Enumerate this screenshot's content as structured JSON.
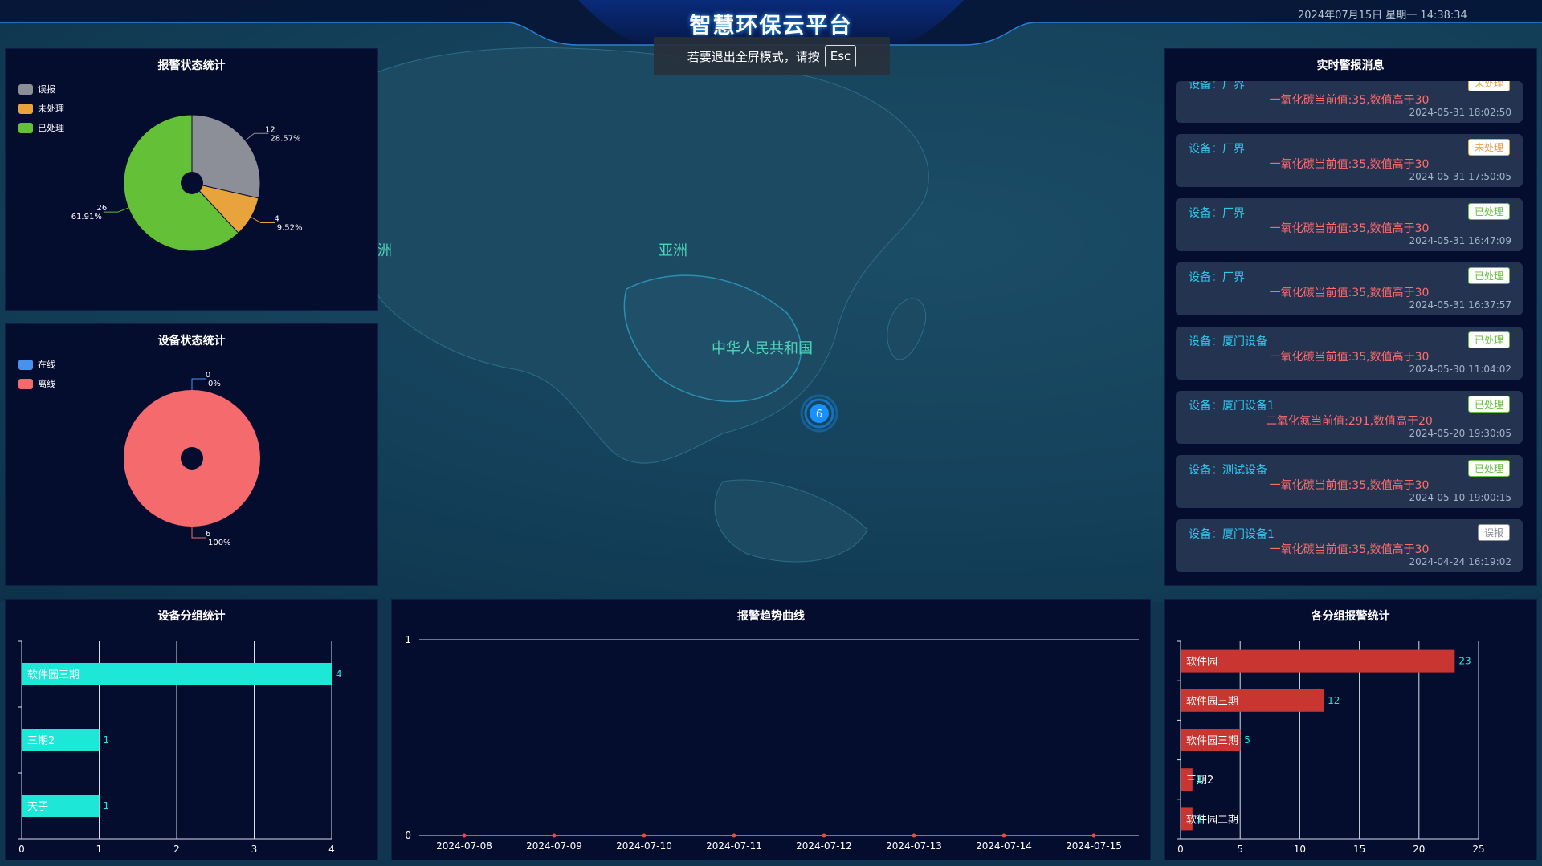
{
  "header": {
    "title": "智慧环保云平台",
    "datetime": "2024年07月15日 星期一 14:38:34",
    "esc_hint": "若要退出全屏模式，请按",
    "esc_key": "Esc"
  },
  "map": {
    "labels": [
      "洲",
      "亚洲",
      "中华人民共和国"
    ],
    "marker_value": "6",
    "colors": {
      "marker": "#1890ff",
      "label": "#4fd3b8"
    }
  },
  "alarm_status": {
    "title": "报警状态统计",
    "chart_data": {
      "type": "pie",
      "title": "报警状态统计",
      "slices": [
        {
          "name": "误报",
          "value": 12,
          "percent": "28.57%",
          "color": "#8c8f98"
        },
        {
          "name": "未处理",
          "value": 4,
          "percent": "9.52%",
          "color": "#e8a33d"
        },
        {
          "name": "已处理",
          "value": 26,
          "percent": "61.91%",
          "color": "#63c037"
        }
      ],
      "legend": "top-left"
    }
  },
  "device_status": {
    "title": "设备状态统计",
    "chart_data": {
      "type": "pie",
      "title": "设备状态统计",
      "slices": [
        {
          "name": "在线",
          "value": 0,
          "percent": "0%",
          "color": "#4892ee"
        },
        {
          "name": "离线",
          "value": 6,
          "percent": "100%",
          "color": "#f56a6c"
        }
      ],
      "legend": "top-left"
    }
  },
  "device_group": {
    "title": "设备分组统计",
    "chart_data": {
      "type": "bar",
      "orientation": "horizontal",
      "title": "设备分组统计",
      "categories": [
        "软件园三期",
        "三期2",
        "天子"
      ],
      "values": [
        4,
        1,
        1
      ],
      "xlim": [
        0,
        4
      ],
      "xticks": [
        "0",
        "1",
        "2",
        "3",
        "4"
      ],
      "color": "#1de8d8",
      "grid": true
    }
  },
  "alarm_trend": {
    "title": "报警趋势曲线",
    "chart_data": {
      "type": "line",
      "title": "报警趋势曲线",
      "x": [
        "2024-07-08",
        "2024-07-09",
        "2024-07-10",
        "2024-07-11",
        "2024-07-12",
        "2024-07-13",
        "2024-07-14",
        "2024-07-15"
      ],
      "series": [
        {
          "values": [
            0,
            0,
            0,
            0,
            0,
            0,
            0,
            0
          ],
          "color": "#e84b4b"
        }
      ],
      "ylim": [
        0,
        1
      ],
      "yticks": [
        "0",
        "1"
      ],
      "grid": true
    }
  },
  "group_alarm": {
    "title": "各分组报警统计",
    "chart_data": {
      "type": "bar",
      "orientation": "horizontal",
      "title": "各分组报警统计",
      "categories": [
        "软件园",
        "软件园三期",
        "软件园三期",
        "三期2",
        "软件园二期"
      ],
      "values": [
        23,
        12,
        5,
        1,
        1
      ],
      "xlim": [
        0,
        25
      ],
      "xticks": [
        "0",
        "5",
        "10",
        "15",
        "20",
        "25"
      ],
      "color": "#c93531",
      "grid": true
    }
  },
  "realtime": {
    "title": "实时警报消息",
    "device_prefix": "设备：",
    "messages": [
      {
        "device": "厂界",
        "status": "未处理",
        "text": "一氧化碳当前值:35,数值高于30",
        "time": "2024-05-31 18:02:50",
        "status_color": "#e8a33d"
      },
      {
        "device": "厂界",
        "status": "未处理",
        "text": "一氧化碳当前值:35,数值高于30",
        "time": "2024-05-31 17:50:05",
        "status_color": "#e8a33d"
      },
      {
        "device": "厂界",
        "status": "已处理",
        "text": "一氧化碳当前值:35,数值高于30",
        "time": "2024-05-31 16:47:09",
        "status_color": "#63c037"
      },
      {
        "device": "厂界",
        "status": "已处理",
        "text": "一氧化碳当前值:35,数值高于30",
        "time": "2024-05-31 16:37:57",
        "status_color": "#63c037"
      },
      {
        "device": "厦门设备",
        "status": "已处理",
        "text": "一氧化碳当前值:35,数值高于30",
        "time": "2024-05-30 11:04:02",
        "status_color": "#63c037"
      },
      {
        "device": "厦门设备1",
        "status": "已处理",
        "text": "二氧化氮当前值:291,数值高于20",
        "time": "2024-05-20 19:30:05",
        "status_color": "#63c037"
      },
      {
        "device": "测试设备",
        "status": "已处理",
        "text": "一氧化碳当前值:35,数值高于30",
        "time": "2024-05-10 19:00:15",
        "status_color": "#63c037"
      },
      {
        "device": "厦门设备1",
        "status": "误报",
        "text": "一氧化碳当前值:35,数值高于30",
        "time": "2024-04-24 16:19:02",
        "status_color": "#8c8f98"
      }
    ]
  }
}
